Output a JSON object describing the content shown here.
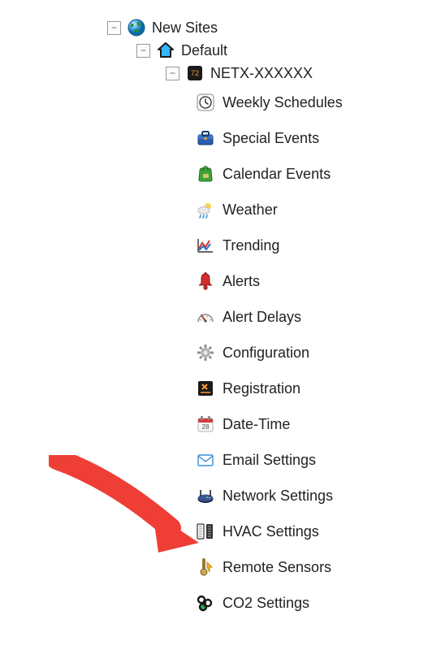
{
  "tree": {
    "root": {
      "label": "New Sites",
      "expanded": true
    },
    "site": {
      "label": "Default",
      "expanded": true
    },
    "device": {
      "label": "NETX-XXXXXX",
      "expanded": true
    },
    "items": [
      {
        "id": "weekly-schedules",
        "label": "Weekly Schedules",
        "icon": "clock-icon"
      },
      {
        "id": "special-events",
        "label": "Special Events",
        "icon": "briefcase-icon"
      },
      {
        "id": "calendar-events",
        "label": "Calendar Events",
        "icon": "green-bag-icon"
      },
      {
        "id": "weather",
        "label": "Weather",
        "icon": "weather-icon"
      },
      {
        "id": "trending",
        "label": "Trending",
        "icon": "trending-icon"
      },
      {
        "id": "alerts",
        "label": "Alerts",
        "icon": "bell-icon"
      },
      {
        "id": "alert-delays",
        "label": "Alert Delays",
        "icon": "gauge-icon"
      },
      {
        "id": "configuration",
        "label": "Configuration",
        "icon": "gear-icon"
      },
      {
        "id": "registration",
        "label": "Registration",
        "icon": "registration-icon"
      },
      {
        "id": "date-time",
        "label": "Date-Time",
        "icon": "calendar-icon"
      },
      {
        "id": "email-settings",
        "label": "Email Settings",
        "icon": "envelope-icon"
      },
      {
        "id": "network-settings",
        "label": "Network Settings",
        "icon": "router-icon"
      },
      {
        "id": "hvac-settings",
        "label": "HVAC Settings",
        "icon": "hvac-icon"
      },
      {
        "id": "remote-sensors",
        "label": "Remote Sensors",
        "icon": "sensor-icon"
      },
      {
        "id": "co2-settings",
        "label": "CO2 Settings",
        "icon": "co2-icon"
      }
    ]
  },
  "annotation": {
    "arrow_target": "hvac-settings",
    "arrow_color": "#ef3e36"
  }
}
